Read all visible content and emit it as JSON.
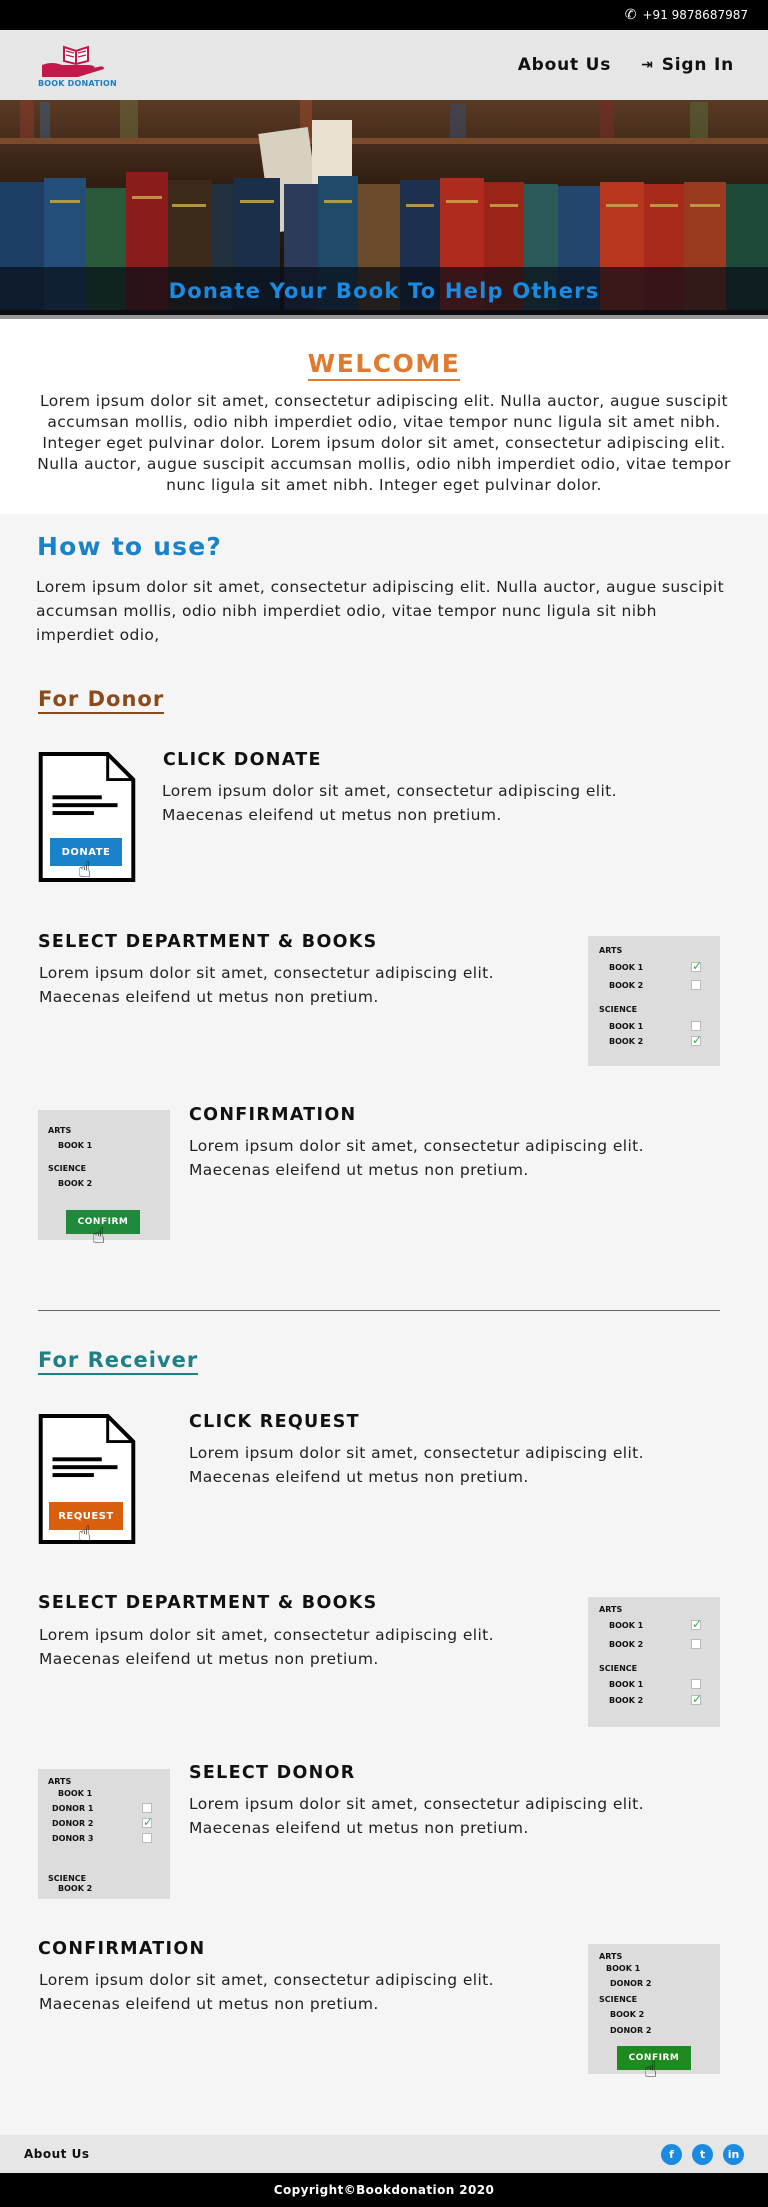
{
  "topbar": {
    "phone": "+91 9878687987",
    "phone_icon": "phone-icon"
  },
  "header": {
    "logo_text": "BOOK DONATION",
    "nav": {
      "about": "About Us",
      "signin": "Sign In"
    }
  },
  "hero": {
    "tagline": "Donate Your Book To Help Others"
  },
  "welcome": {
    "title": "WELCOME",
    "text": "Lorem ipsum dolor sit amet, consectetur adipiscing elit. Nulla auctor, augue suscipit accumsan mollis, odio nibh imperdiet odio, vitae tempor nunc ligula sit amet nibh. Integer eget pulvinar dolor. Lorem ipsum dolor sit amet, consectetur adipiscing elit. Nulla auctor, augue suscipit accumsan mollis, odio nibh imperdiet odio, vitae tempor nunc ligula sit amet nibh. Integer eget pulvinar dolor."
  },
  "how": {
    "title": "How to use?",
    "intro": "Lorem ipsum dolor sit amet, consectetur adipiscing elit. Nulla auctor, augue suscipit accumsan mollis, odio nibh imperdiet odio, vitae tempor nunc ligula sit nibh imperdiet odio,"
  },
  "donor": {
    "heading": "For Donor",
    "step1": {
      "title": "CLICK DONATE",
      "text": "Lorem ipsum dolor sit amet, consectetur adipiscing elit. Maecenas eleifend ut metus non pretium.",
      "button": "DONATE"
    },
    "step2": {
      "title": "SELECT DEPARTMENT & BOOKS",
      "text": "Lorem ipsum dolor sit amet, consectetur adipiscing elit. Maecenas eleifend ut metus non pretium.",
      "panel": {
        "dept1": "ARTS",
        "book1": "BOOK 1",
        "book2": "BOOK 2",
        "dept2": "SCIENCE",
        "book3": "BOOK 1",
        "book4": "BOOK 2"
      }
    },
    "step3": {
      "title": "CONFIRMATION",
      "text": "Lorem ipsum dolor sit amet, consectetur adipiscing elit. Maecenas eleifend ut metus non pretium.",
      "panel": {
        "dept1": "ARTS",
        "book1": "BOOK 1",
        "dept2": "SCIENCE",
        "book2": "BOOK 2",
        "button": "CONFIRM"
      }
    }
  },
  "receiver": {
    "heading": "For Receiver",
    "step1": {
      "title": "CLICK REQUEST",
      "text": "Lorem ipsum dolor sit amet, consectetur adipiscing elit. Maecenas eleifend ut metus non pretium.",
      "button": "REQUEST"
    },
    "step2": {
      "title": "SELECT DEPARTMENT & BOOKS",
      "text": "Lorem ipsum dolor sit amet, consectetur adipiscing elit. Maecenas eleifend ut metus non pretium.",
      "panel": {
        "dept1": "ARTS",
        "book1": "BOOK 1",
        "book2": "BOOK 2",
        "dept2": "SCIENCE",
        "book3": "BOOK 1",
        "book4": "BOOK 2"
      }
    },
    "step3": {
      "title": "SELECT DONOR",
      "text": "Lorem ipsum dolor sit amet, consectetur adipiscing elit. Maecenas eleifend ut metus non pretium.",
      "panel": {
        "dept1": "ARTS",
        "book1": "BOOK 1",
        "donor1": "DONOR 1",
        "donor2": "DONOR 2",
        "donor3": "DONOR 3",
        "dept2": "SCIENCE",
        "book2": "BOOK 2"
      }
    },
    "step4": {
      "title": "CONFIRMATION",
      "text": "Lorem ipsum dolor sit amet, consectetur adipiscing elit. Maecenas eleifend ut metus non pretium.",
      "panel": {
        "dept1": "ARTS",
        "book1": "BOOK 1",
        "donor1": "DONOR 2",
        "dept2": "SCIENCE",
        "book2": "BOOK 2",
        "donor2": "DONOR 2",
        "button": "CONFIRM"
      }
    }
  },
  "footer": {
    "about": "About Us",
    "copyright": "Copyright©Bookdonation 2020",
    "social": [
      "f",
      "t",
      "in"
    ]
  },
  "colors": {
    "accent_blue": "#1a82c8",
    "welcome_orange": "#e07a2e",
    "donor_brown": "#8b4a1c",
    "receiver_teal": "#1e7f86",
    "confirm_green": "#1f8a3c",
    "request_orange": "#d95f0e"
  }
}
